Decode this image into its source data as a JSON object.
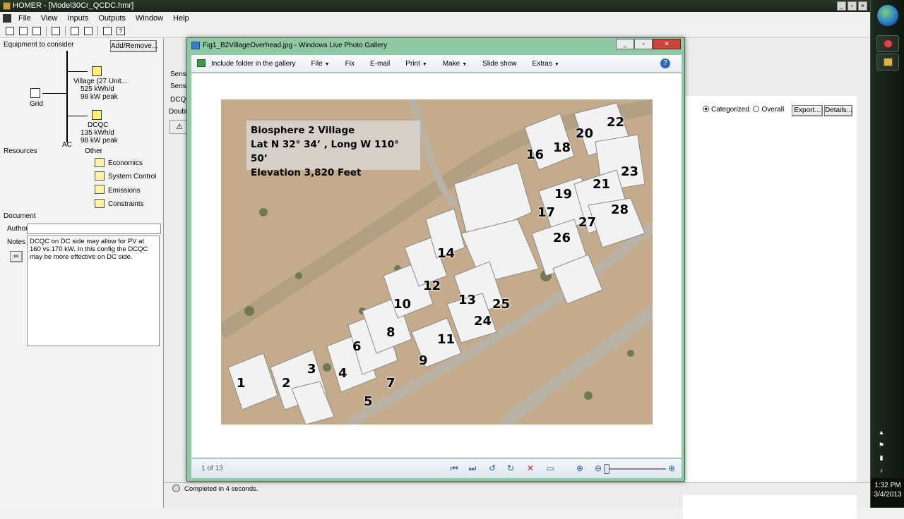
{
  "homer": {
    "title": "HOMER - [Model30Cr_QCDC.hmr]",
    "menu": [
      "File",
      "View",
      "Inputs",
      "Outputs",
      "Window",
      "Help"
    ],
    "equipment_label": "Equipment to consider",
    "add_remove": "Add/Remove...",
    "components": {
      "village": {
        "name": "Village (27 Unit...",
        "energy": "525 kWh/d",
        "peak": "98 kW peak"
      },
      "dcqc": {
        "name": "DCQC",
        "energy": "135 kWh/d",
        "peak": "98 kW peak"
      },
      "grid": "Grid",
      "bus": "AC"
    },
    "resources_label": "Resources",
    "other_label": "Other",
    "other_items": [
      "Economics",
      "System Control",
      "Emissions",
      "Constraints"
    ],
    "document_label": "Document",
    "author_label": "Author",
    "author_value": "",
    "notes_label": "Notes",
    "notes_text": "DCQC on DC side may allow for PV at 160 vs 170 kW.  In this config the DCQC may be more effective on DC side.",
    "sens_labels": [
      "Sensiti",
      "Sensiti",
      "DCQC",
      "Double"
    ],
    "results": {
      "categorized": "Categorized",
      "overall": "Overall",
      "export": "Export...",
      "details": "Details..."
    },
    "status": "Completed in 4 seconds."
  },
  "gallery": {
    "title": "Fig1_B2VillageOverhead.jpg - Windows Live Photo Gallery",
    "commands": [
      {
        "label": "Include folder in the gallery",
        "dropdown": false
      },
      {
        "label": "File",
        "dropdown": true
      },
      {
        "label": "Fix",
        "dropdown": false
      },
      {
        "label": "E-mail",
        "dropdown": false
      },
      {
        "label": "Print",
        "dropdown": true
      },
      {
        "label": "Make",
        "dropdown": true
      },
      {
        "label": "Slide show",
        "dropdown": false
      },
      {
        "label": "Extras",
        "dropdown": true
      }
    ],
    "photo_caption": {
      "line1": "Biosphere 2 Village",
      "line2": "Lat  N 32° 34’ , Long W 110° 50’",
      "line3": "Elevation 3,820 Feet"
    },
    "building_numbers": [
      "1",
      "2",
      "3",
      "4",
      "5",
      "6",
      "7",
      "8",
      "9",
      "10",
      "11",
      "12",
      "13",
      "14",
      "16",
      "17",
      "18",
      "19",
      "20",
      "21",
      "22",
      "23",
      "24",
      "25",
      "26",
      "27",
      "28"
    ],
    "counter": "1 of 13",
    "photo_colors": {
      "ground": "#c4ab8c",
      "road": "#b9b3a6",
      "roof": "#f2f2f2",
      "vegetation": "#6f7a52"
    }
  },
  "taskbar": {
    "time": "1:32 PM",
    "date": "3/4/2013"
  }
}
